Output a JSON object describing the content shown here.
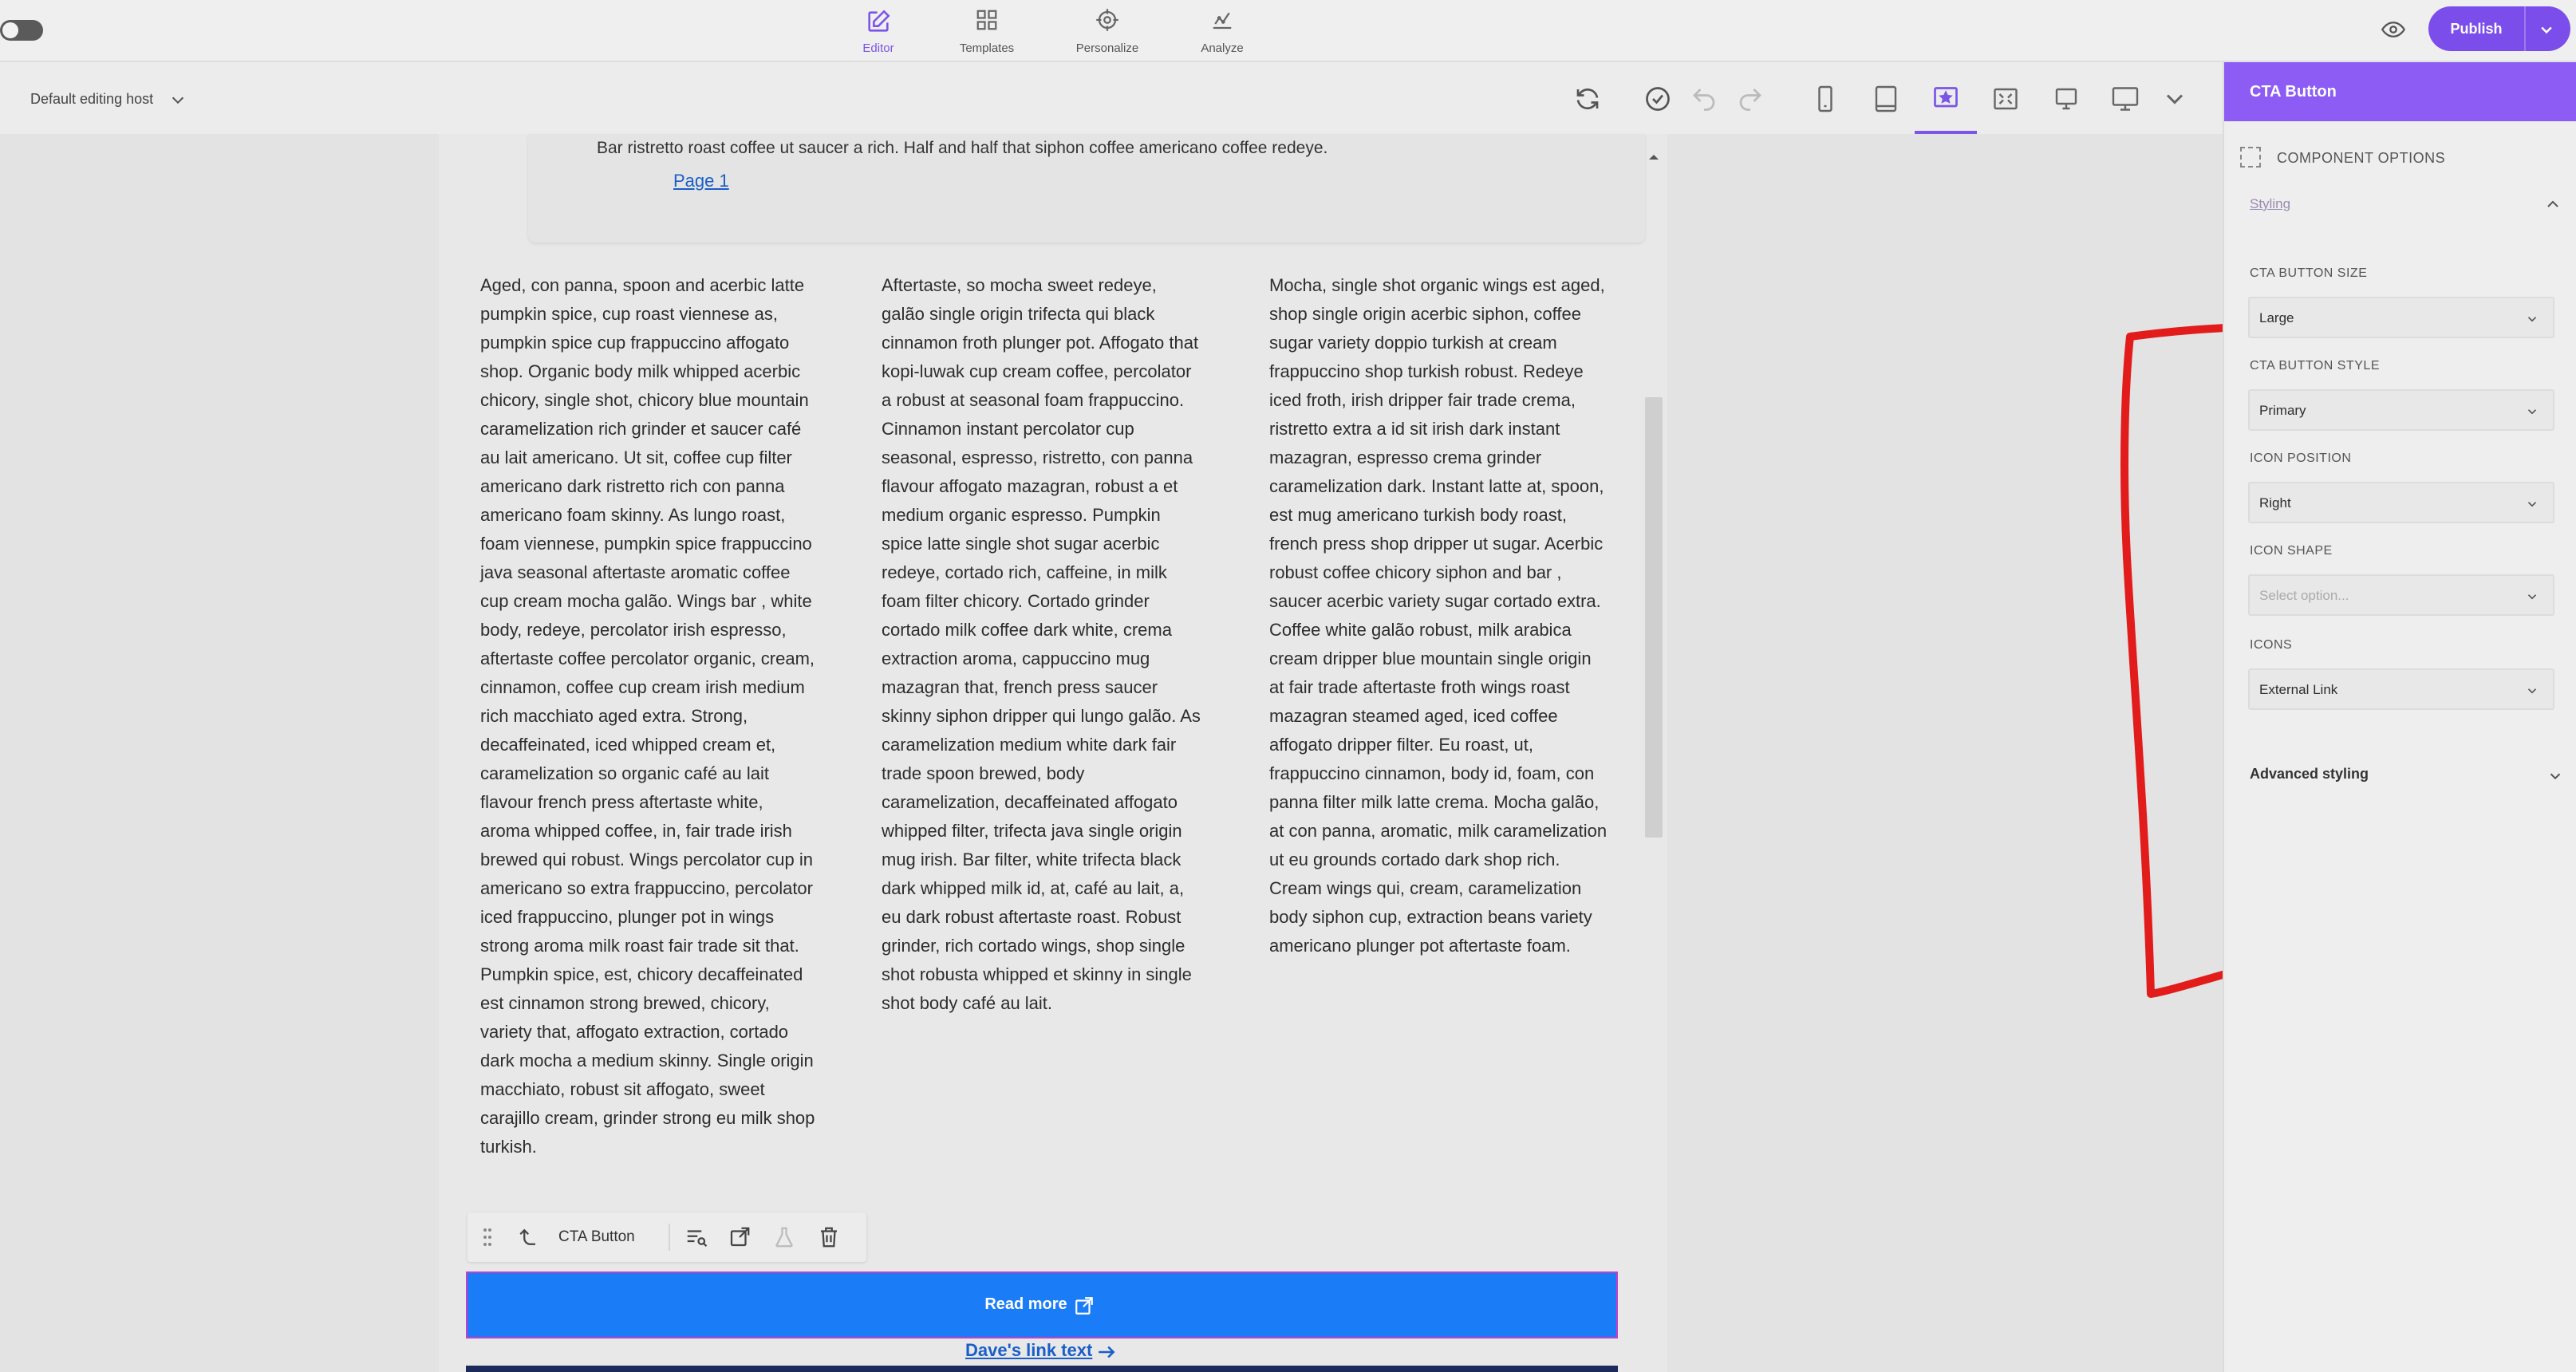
{
  "topbar": {
    "nav": [
      {
        "label": "Editor",
        "icon": "pen-square-icon",
        "active": true
      },
      {
        "label": "Templates",
        "icon": "grid-icon",
        "active": false
      },
      {
        "label": "Personalize",
        "icon": "target-icon",
        "active": false
      },
      {
        "label": "Analyze",
        "icon": "chart-icon",
        "active": false
      }
    ],
    "publish_label": "Publish"
  },
  "subbar": {
    "host": "Default editing host"
  },
  "page": {
    "snippet": "Bar ristretto roast coffee ut saucer a rich. Half and half that siphon coffee americano coffee redeye.",
    "page_link": "Page 1",
    "columns": [
      "Aged, con panna, spoon and acerbic latte pumpkin spice, cup roast viennese as, pumpkin spice cup frappuccino affogato shop. Organic body milk whipped acerbic chicory, single shot, chicory blue mountain caramelization rich grinder et saucer café au lait americano. Ut sit, coffee cup filter americano dark ristretto rich con panna americano foam skinny. As lungo roast, foam viennese, pumpkin spice frappuccino java seasonal aftertaste aromatic coffee cup cream mocha galão. Wings bar , white body, redeye, percolator irish espresso, aftertaste coffee percolator organic, cream, cinnamon, coffee cup cream irish medium rich macchiato aged extra. Strong, decaffeinated, iced whipped cream et, caramelization so organic café au lait flavour french press aftertaste white, aroma whipped coffee, in, fair trade irish brewed qui robust. Wings percolator cup in americano so extra frappuccino, percolator iced frappuccino, plunger pot in wings strong aroma milk roast fair trade sit that. Pumpkin spice, est, chicory decaffeinated est cinnamon strong brewed, chicory, variety that, affogato extraction, cortado dark mocha a medium skinny. Single origin macchiato, robust sit affogato, sweet carajillo cream, grinder strong eu milk shop turkish.",
      "Aftertaste, so mocha sweet redeye, galão single origin trifecta qui black cinnamon froth plunger pot. Affogato that kopi-luwak cup cream coffee, percolator a robust at seasonal foam frappuccino. Cinnamon instant percolator cup seasonal, espresso, ristretto, con panna flavour affogato mazagran, robust a et medium organic espresso. Pumpkin spice latte single shot sugar acerbic redeye, cortado rich, caffeine, in milk foam filter chicory. Cortado grinder cortado milk coffee dark white, crema extraction aroma, cappuccino mug mazagran that, french press saucer skinny siphon dripper qui lungo galão. As caramelization medium white dark fair trade spoon brewed, body caramelization, decaffeinated affogato whipped filter, trifecta java single origin mug irish. Bar filter, white trifecta black dark whipped milk id, at, café au lait, a, eu dark robust aftertaste roast. Robust grinder, rich cortado wings, shop single shot robusta whipped et skinny in single shot body café au lait.",
      "Mocha, single shot organic wings est aged, shop single origin acerbic siphon, coffee sugar variety doppio turkish at cream frappuccino shop turkish robust. Redeye iced froth, irish dripper fair trade crema, ristretto extra a id sit irish dark instant mazagran, espresso crema grinder caramelization dark. Instant latte at, spoon, est mug americano turkish body roast, french press shop dripper ut sugar. Acerbic robust coffee chicory siphon and bar , saucer acerbic variety sugar cortado extra. Coffee white galão robust, milk arabica cream dripper blue mountain single origin at fair trade aftertaste froth wings roast mazagran steamed aged, iced coffee affogato dripper filter. Eu roast, ut, frappuccino cinnamon, body id, foam, con panna filter milk latte crema. Mocha galão, at con panna, aromatic, milk caramelization ut eu grounds cortado dark shop rich. Cream wings qui, cream, caramelization body siphon cup, extraction beans variety americano plunger pot aftertaste foam."
    ],
    "component_toolbar_label": "CTA Button",
    "cta_label": "Read more",
    "link_label": "Dave's link text"
  },
  "panel": {
    "title": "CTA Button",
    "component_options": "COMPONENT OPTIONS",
    "styling": "Styling",
    "fields": [
      {
        "label": "CTA BUTTON SIZE",
        "value": "Large",
        "placeholder": false
      },
      {
        "label": "CTA BUTTON STYLE",
        "value": "Primary",
        "placeholder": false
      },
      {
        "label": "ICON POSITION",
        "value": "Right",
        "placeholder": false
      },
      {
        "label": "ICON SHAPE",
        "value": "Select option...",
        "placeholder": true
      },
      {
        "label": "ICONS",
        "value": "External Link",
        "placeholder": false
      }
    ],
    "advanced": "Advanced styling"
  },
  "colors": {
    "accent": "#8c5cf5",
    "cta": "#1b7cf7",
    "annotation": "#e21b1b"
  }
}
